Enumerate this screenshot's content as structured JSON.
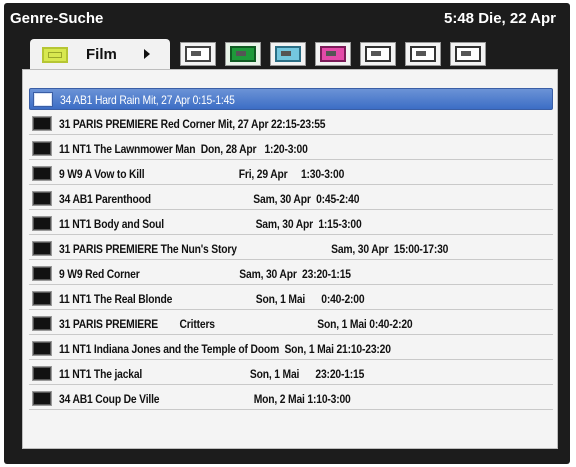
{
  "header": {
    "title": "Genre-Suche",
    "clock": "5:48 Die, 22 Apr"
  },
  "tabs": {
    "active_label": "Film",
    "icons": [
      "film-icon",
      "tv-icon",
      "nature-icon",
      "sports-icon",
      "kids-icon",
      "book-icon",
      "house-icon",
      "social-icon"
    ]
  },
  "colors": {
    "selection": "#4a78c8",
    "background": "#1c1c1c",
    "list_bg": "#f4f4f4"
  },
  "results": [
    "34 AB1 Hard Rain Mit, 27 Apr 0:15-1:45",
    "31 PARIS PREMIERE Red Corner Mit, 27 Apr 22:15-23:55",
    "11 NT1 The Lawnmower Man  Don, 28 Apr   1:20-3:00",
    "9 W9 A Vow to Kill                                   Fri, 29 Apr     1:30-3:00",
    "34 AB1 Parenthood                                      Sam, 30 Apr  0:45-2:40",
    "11 NT1 Body and Soul                                  Sam, 30 Apr  1:15-3:00",
    "31 PARIS PREMIERE The Nun's Story                                   Sam, 30 Apr  15:00-17:30",
    "9 W9 Red Corner                                     Sam, 30 Apr  23:20-1:15",
    "11 NT1 The Real Blonde                               Son, 1 Mai      0:40-2:00",
    "31 PARIS PREMIERE        Critters                                      Son, 1 Mai 0:40-2:20",
    "11 NT1 Indiana Jones and the Temple of Doom  Son, 1 Mai 21:10-23:20",
    "11 NT1 The jackal                                        Son, 1 Mai      23:20-1:15",
    "34 AB1 Coup De Ville                                   Mon, 2 Mai 1:10-3:00"
  ]
}
